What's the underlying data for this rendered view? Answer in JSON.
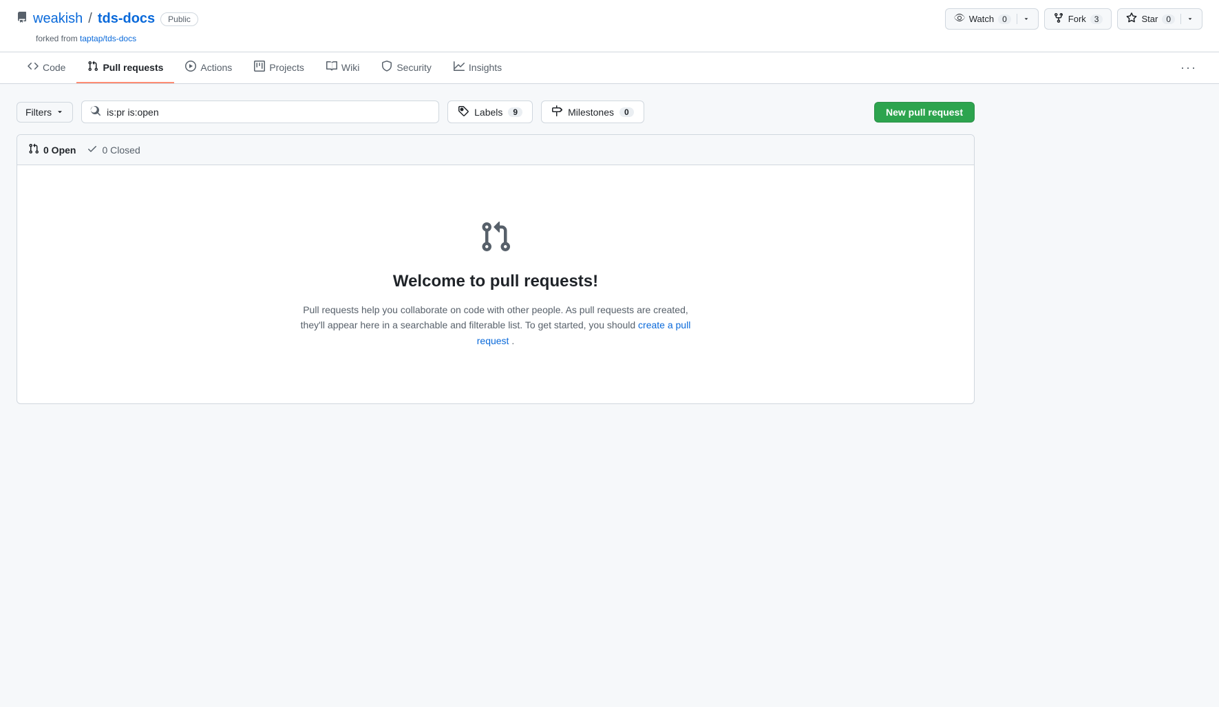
{
  "header": {
    "org_name": "weakish",
    "separator": "/",
    "repo_name": "tds-docs",
    "public_badge": "Public",
    "fork_text": "forked from",
    "fork_link_text": "taptap/tds-docs",
    "fork_link_href": "#"
  },
  "header_actions": {
    "watch_label": "Watch",
    "watch_count": "0",
    "fork_label": "Fork",
    "fork_count": "3",
    "star_label": "Star",
    "star_count": "0"
  },
  "nav": {
    "tabs": [
      {
        "id": "code",
        "label": "Code",
        "icon": "code"
      },
      {
        "id": "pull-requests",
        "label": "Pull requests",
        "icon": "pr",
        "active": true
      },
      {
        "id": "actions",
        "label": "Actions",
        "icon": "play"
      },
      {
        "id": "projects",
        "label": "Projects",
        "icon": "grid"
      },
      {
        "id": "wiki",
        "label": "Wiki",
        "icon": "book"
      },
      {
        "id": "security",
        "label": "Security",
        "icon": "shield"
      },
      {
        "id": "insights",
        "label": "Insights",
        "icon": "chart"
      }
    ],
    "more_label": "···"
  },
  "toolbar": {
    "filters_label": "Filters",
    "search_value": "is:pr is:open",
    "labels_label": "Labels",
    "labels_count": "9",
    "milestones_label": "Milestones",
    "milestones_count": "0",
    "new_pr_label": "New pull request"
  },
  "pr_status": {
    "open_icon": "pr-open",
    "open_label": "0 Open",
    "closed_icon": "check",
    "closed_label": "0 Closed"
  },
  "empty_state": {
    "title": "Welcome to pull requests!",
    "description_before": "Pull requests help you collaborate on code with other people. As pull requests are created, they'll appear here in a searchable and filterable list. To get started, you should",
    "link_text": "create a pull request",
    "description_after": "."
  }
}
